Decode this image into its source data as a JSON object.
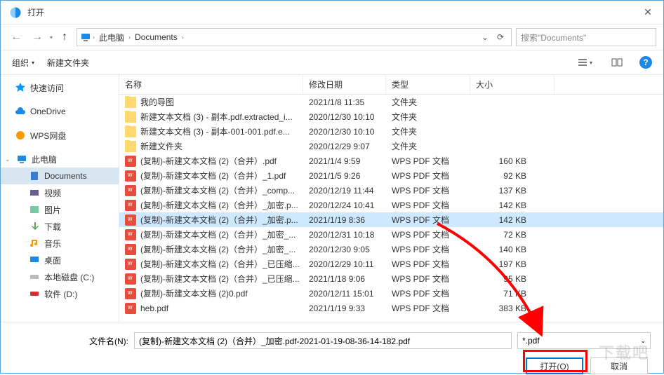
{
  "window": {
    "title": "打开"
  },
  "path": {
    "segments": [
      "此电脑",
      "Documents"
    ]
  },
  "search": {
    "placeholder": "搜索\"Documents\""
  },
  "toolbar": {
    "organize": "组织",
    "newfolder": "新建文件夹"
  },
  "sidebar": {
    "items": [
      {
        "label": "快速访问",
        "icon": "star",
        "cls": "i-star"
      },
      {
        "label": "OneDrive",
        "icon": "cloud",
        "cls": "i-cloud"
      },
      {
        "label": "WPS网盘",
        "icon": "wps",
        "cls": "i-wps"
      },
      {
        "label": "此电脑",
        "icon": "monitor",
        "cls": "i-monitor",
        "expandable": true
      },
      {
        "label": "Documents",
        "icon": "doc",
        "cls": "i-doc",
        "lvl": 2,
        "selected": true
      },
      {
        "label": "视频",
        "icon": "vid",
        "cls": "i-vid",
        "lvl": 2
      },
      {
        "label": "图片",
        "icon": "pic",
        "cls": "i-pic",
        "lvl": 2
      },
      {
        "label": "下载",
        "icon": "down",
        "cls": "i-down",
        "lvl": 2
      },
      {
        "label": "音乐",
        "icon": "music",
        "cls": "i-music",
        "lvl": 2
      },
      {
        "label": "桌面",
        "icon": "desk",
        "cls": "i-desk",
        "lvl": 2
      },
      {
        "label": "本地磁盘 (C:)",
        "icon": "disk",
        "cls": "i-disk",
        "lvl": 2
      },
      {
        "label": "软件 (D:)",
        "icon": "soft",
        "cls": "i-soft",
        "lvl": 2
      }
    ]
  },
  "columns": {
    "name": "名称",
    "date": "修改日期",
    "type": "类型",
    "size": "大小"
  },
  "files": [
    {
      "name": "我的导图",
      "date": "2021/1/8 11:35",
      "type": "文件夹",
      "size": "",
      "kind": "folder"
    },
    {
      "name": "新建文本文档 (3) - 副本.pdf.extracted_i...",
      "date": "2020/12/30 10:10",
      "type": "文件夹",
      "size": "",
      "kind": "folder"
    },
    {
      "name": "新建文本文档 (3) - 副本-001-001.pdf.e...",
      "date": "2020/12/30 10:10",
      "type": "文件夹",
      "size": "",
      "kind": "folder"
    },
    {
      "name": "新建文件夹",
      "date": "2020/12/29 9:07",
      "type": "文件夹",
      "size": "",
      "kind": "folder"
    },
    {
      "name": "(复制)-新建文本文档 (2)（合并）.pdf",
      "date": "2021/1/4 9:59",
      "type": "WPS PDF 文档",
      "size": "160 KB",
      "kind": "pdf"
    },
    {
      "name": "(复制)-新建文本文档 (2)（合并）_1.pdf",
      "date": "2021/1/5 9:26",
      "type": "WPS PDF 文档",
      "size": "92 KB",
      "kind": "pdf"
    },
    {
      "name": "(复制)-新建文本文档 (2)（合并）_comp...",
      "date": "2020/12/19 11:44",
      "type": "WPS PDF 文档",
      "size": "137 KB",
      "kind": "pdf"
    },
    {
      "name": "(复制)-新建文本文档 (2)（合并）_加密.p...",
      "date": "2020/12/24 10:41",
      "type": "WPS PDF 文档",
      "size": "142 KB",
      "kind": "pdf"
    },
    {
      "name": "(复制)-新建文本文档 (2)（合并）_加密.p...",
      "date": "2021/1/19 8:36",
      "type": "WPS PDF 文档",
      "size": "142 KB",
      "kind": "pdf",
      "selected": true
    },
    {
      "name": "(复制)-新建文本文档 (2)（合并）_加密_...",
      "date": "2020/12/31 10:18",
      "type": "WPS PDF 文档",
      "size": "72 KB",
      "kind": "pdf"
    },
    {
      "name": "(复制)-新建文本文档 (2)（合并）_加密_...",
      "date": "2020/12/30 9:05",
      "type": "WPS PDF 文档",
      "size": "140 KB",
      "kind": "pdf"
    },
    {
      "name": "(复制)-新建文本文档 (2)（合并）_已压缩...",
      "date": "2020/12/29 10:11",
      "type": "WPS PDF 文档",
      "size": "197 KB",
      "kind": "pdf"
    },
    {
      "name": "(复制)-新建文本文档 (2)（合并）_已压缩...",
      "date": "2021/1/18 9:06",
      "type": "WPS PDF 文档",
      "size": "95 KB",
      "kind": "pdf"
    },
    {
      "name": "(复制)-新建文本文档 (2)0.pdf",
      "date": "2020/12/11 15:01",
      "type": "WPS PDF 文档",
      "size": "71 KB",
      "kind": "pdf"
    },
    {
      "name": "heb.pdf",
      "date": "2021/1/19 9:33",
      "type": "WPS PDF 文档",
      "size": "383 KB",
      "kind": "pdf"
    }
  ],
  "footer": {
    "filename_label": "文件名(N):",
    "filename_value": "(复制)-新建文本文档 (2)（合并）_加密.pdf-2021-01-19-08-36-14-182.pdf",
    "filetype": "*.pdf",
    "open": "打开(O)",
    "cancel": "取消"
  },
  "watermark": "下载吧"
}
